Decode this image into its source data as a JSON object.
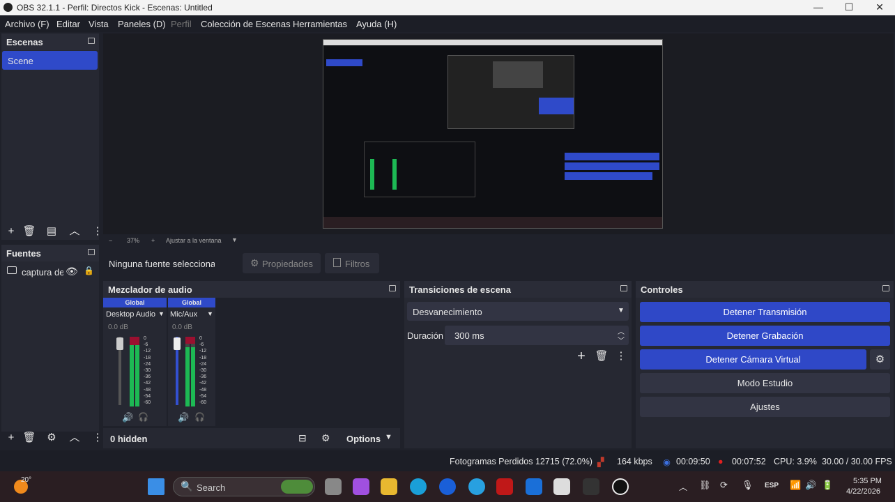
{
  "window": {
    "title": "OBS 32.1.1 - Perfil: Directos Kick - Escenas: Untitled",
    "minimize": "—",
    "maximize": "☐",
    "close": "✕"
  },
  "menu": [
    "Archivo (F)",
    "Editar",
    "Vista",
    "Paneles (D)",
    "Perfil",
    "Colección de Escenas",
    "Herramientas",
    "Ayuda (H)"
  ],
  "scenes": {
    "title": "Escenas",
    "items": [
      "Scene"
    ]
  },
  "sources": {
    "title": "Fuentes",
    "items": [
      "captura de"
    ]
  },
  "zoom": {
    "minus": "−",
    "value": "37%",
    "plus": "+",
    "fit": "Ajustar a la ventana"
  },
  "source_toolbar": {
    "none": "Ninguna fuente seleccionad",
    "properties": "Propiedades",
    "filters": "Filtros"
  },
  "mixer": {
    "title": "Mezclador de audio",
    "channels": [
      {
        "badge": "Global",
        "name": "Desktop Audio",
        "db": "0.0 dB",
        "level": 0.92
      },
      {
        "badge": "Global",
        "name": "Mic/Aux",
        "db": "0.0 dB",
        "level": 0.85
      }
    ],
    "scale": [
      "0",
      "-6",
      "-12",
      "-18",
      "-24",
      "-30",
      "-36",
      "-42",
      "-48",
      "-54",
      "-60"
    ],
    "hidden": "0 hidden",
    "options": "Options"
  },
  "transitions": {
    "title": "Transiciones de escena",
    "type": "Desvanecimiento",
    "duration_label": "Duración",
    "duration": "300 ms"
  },
  "controls": {
    "title": "Controles",
    "stop_stream": "Detener Transmisión",
    "stop_record": "Detener Grabación",
    "stop_vcam": "Detener Cámara Virtual",
    "studio": "Modo Estudio",
    "settings": "Ajustes"
  },
  "status": {
    "dropped": "Fotogramas Perdidos 12715 (72.0%)",
    "bitrate": "164 kbps",
    "stream_time": "00:09:50",
    "record_time": "00:07:52",
    "cpu": "CPU: 3.9%",
    "fps": "30.00 / 30.00 FPS"
  },
  "taskbar": {
    "temp": "20°",
    "search": "Search",
    "lang": "ESP",
    "time": "5:35 PM",
    "date": "4/22/2026"
  }
}
